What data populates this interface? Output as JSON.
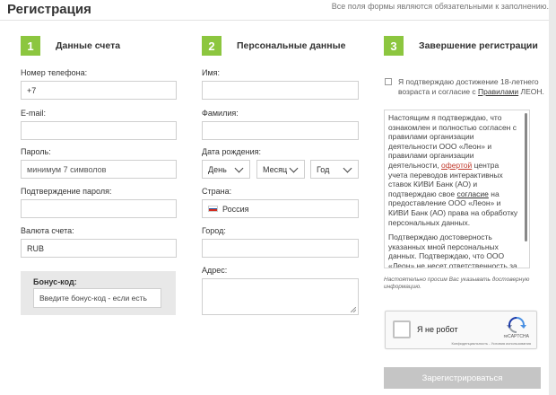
{
  "header": {
    "title": "Регистрация",
    "required_note": "Все поля формы являются обязательными к заполнению."
  },
  "steps": [
    {
      "number": "1",
      "title": "Данные счета"
    },
    {
      "number": "2",
      "title": "Персональные данные"
    },
    {
      "number": "3",
      "title": "Завершение регистрации"
    }
  ],
  "account": {
    "phone": {
      "label": "Номер телефона:",
      "value": "+7"
    },
    "email": {
      "label": "E-mail:",
      "value": ""
    },
    "password": {
      "label": "Пароль:",
      "placeholder": "минимум 7 символов"
    },
    "password_confirm": {
      "label": "Подтверждение пароля:",
      "value": ""
    },
    "currency": {
      "label": "Валюта счета:",
      "value": "RUB"
    },
    "bonus": {
      "label": "Бонус-код:",
      "placeholder": "Введите бонус-код - если есть"
    }
  },
  "personal": {
    "first_name": {
      "label": "Имя:",
      "value": ""
    },
    "last_name": {
      "label": "Фамилия:",
      "value": ""
    },
    "birth_date": {
      "label": "Дата рождения:",
      "day": "День",
      "month": "Месяц",
      "year": "Год"
    },
    "country": {
      "label": "Страна:",
      "value": "Россия"
    },
    "city": {
      "label": "Город:",
      "value": ""
    },
    "address": {
      "label": "Адрес:",
      "value": ""
    }
  },
  "finish": {
    "agree_text": "Я подтверждаю достижение 18-летнего возраста и согласие с",
    "agree_link": "Правилами",
    "agree_suffix": "ЛЕОН.",
    "terms_p1_a": "Настоящим я подтверждаю, что ознакомлен и полностью согласен с правилами организации деятельности ООО «Леон» и правилами организации деятельности,",
    "terms_p1_offer": "офертой",
    "terms_p1_b": "центра учета переводов интерактивных ставок КИВИ Банк (АО) и подтверждаю свое",
    "terms_p1_consent": "согласие",
    "terms_p1_c": "на предоставление ООО «Леон» и КИВИ Банк (АО) права на обработку персональных данных.",
    "terms_p2": "Подтверждаю достоверность указанных мной персональных данных. Подтверждаю, что ООО «Леон» не несет ответственность за деятельность платежных систем, платежных агентов и любых других операторов",
    "terms_note": "Настоятельно просим Вас указывать достоверную информацию.",
    "captcha_label": "Я не робот",
    "captcha_brand": "reCAPTCHA",
    "captcha_links": "Конфиденциальность - Условия использования",
    "register_label": "Зарегистрироваться"
  },
  "colors": {
    "accent": "#8cc63f",
    "button_disabled": "#c5c5c5",
    "offer_link": "#c0392b"
  }
}
